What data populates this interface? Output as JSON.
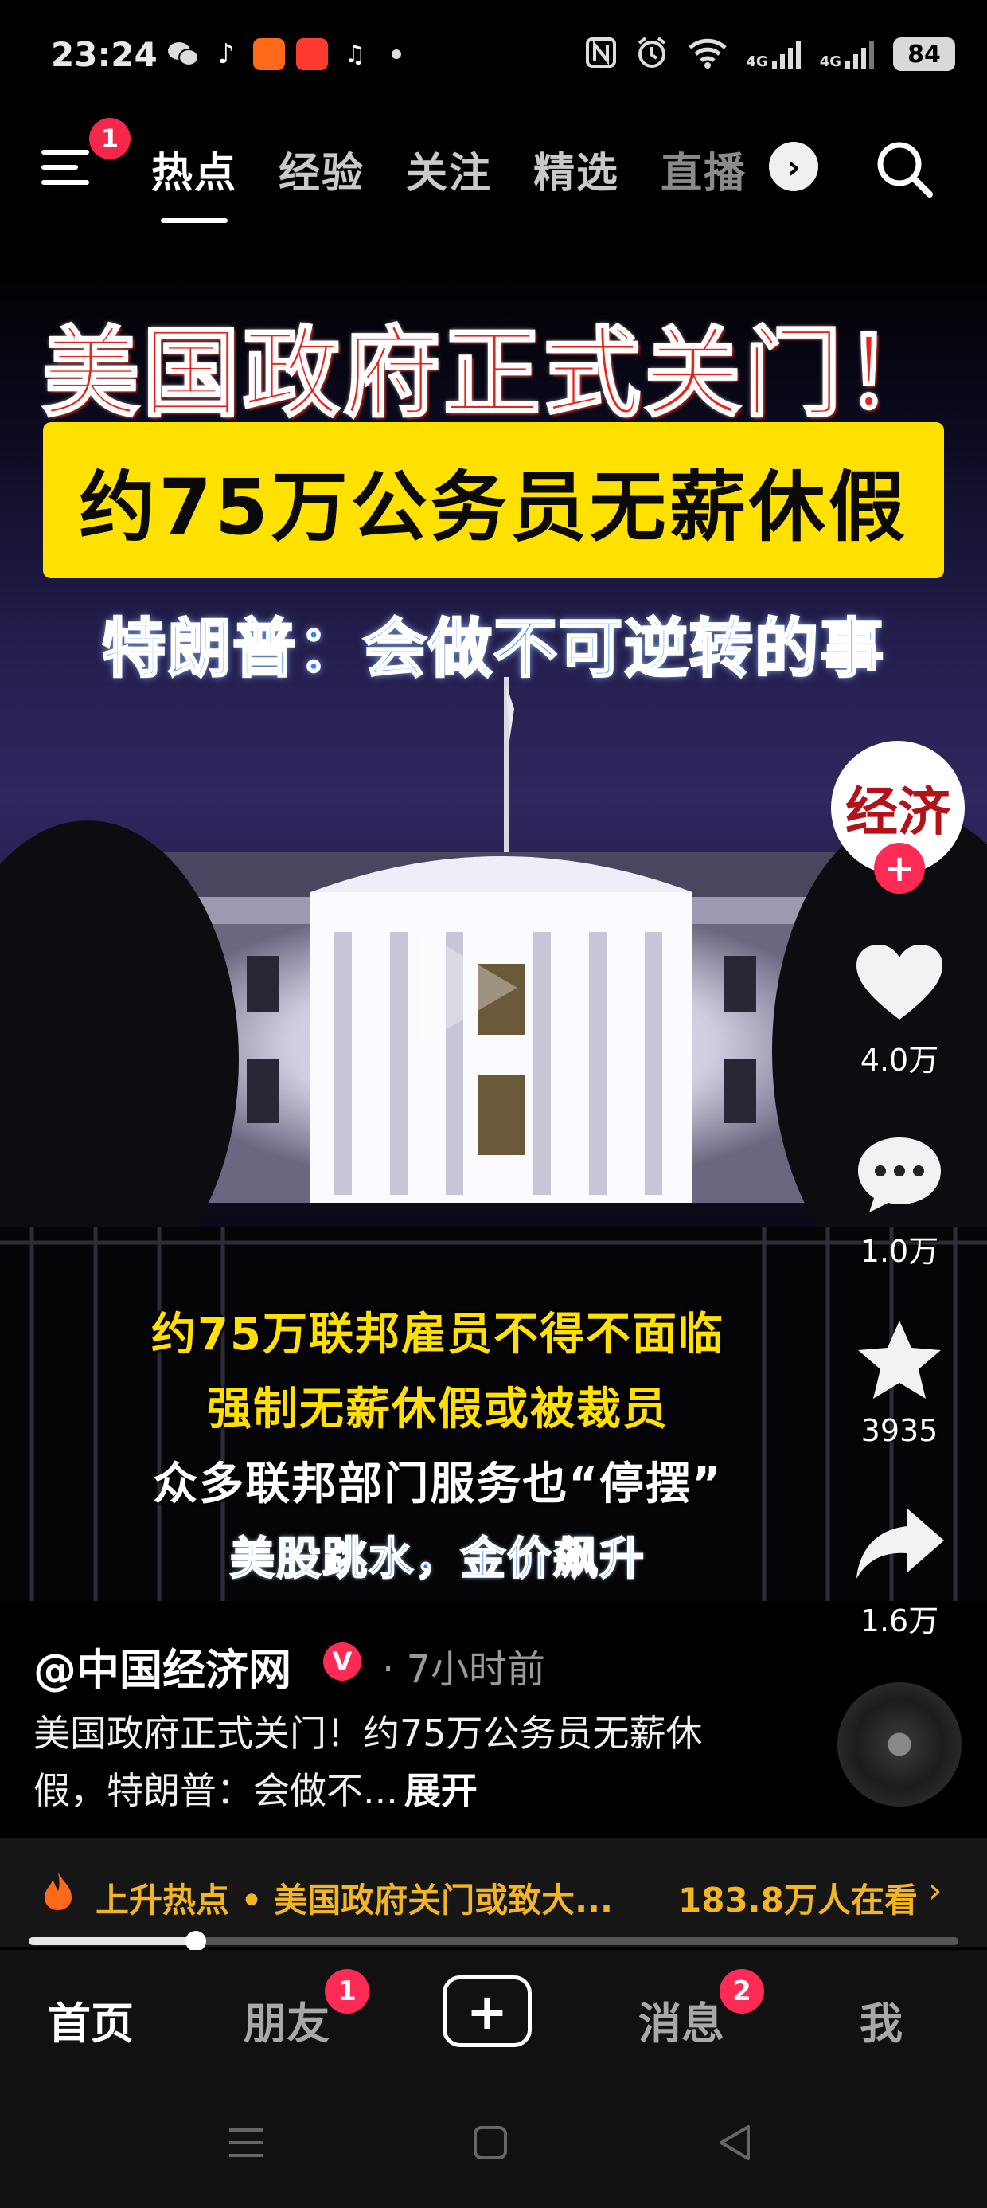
{
  "status_bar": {
    "time": "23:24",
    "network_label_1": "4G",
    "network_label_2": "4G",
    "battery": "84"
  },
  "top_nav": {
    "menu_badge": "1",
    "tabs": [
      {
        "label": "热点",
        "active": true
      },
      {
        "label": "经验",
        "active": false
      },
      {
        "label": "关注",
        "active": false
      },
      {
        "label": "精选",
        "active": false
      },
      {
        "label": "直播",
        "active": false
      }
    ],
    "more_icon": "chevron-right-icon",
    "search_icon": "search-icon"
  },
  "video": {
    "headline": "美国政府正式关门！",
    "banner": "约75万公务员无薪休假",
    "quote": "特朗普：会做不可逆转的事",
    "subtitles": [
      {
        "text": "约75万联邦雇员不得不面临",
        "style": "yellow"
      },
      {
        "text": "强制无薪休假或被裁员",
        "style": "yellow"
      },
      {
        "text": "众多联邦部门服务也“停摆”",
        "style": "white"
      },
      {
        "text": "美股跳水，金价飙升",
        "style": "blue"
      }
    ]
  },
  "actions": {
    "avatar_logo": "经济",
    "likes": "4.0万",
    "comments": "1.0万",
    "favorites": "3935",
    "shares": "1.6万"
  },
  "post": {
    "author": "@中国经济网",
    "verified_mark": "V",
    "time": "· 7小时前",
    "caption": "美国政府正式关门！约75万公务员无薪休假，特朗普：会做不...",
    "expand": "展开"
  },
  "trending": {
    "text": "上升热点 • 美国政府关门或致大...",
    "viewers": "183.8万人在看",
    "arrow": "›"
  },
  "playback": {
    "progress": 0.18
  },
  "bottom_nav": {
    "home": "首页",
    "friends": "朋友",
    "friends_badge": "1",
    "create": "+",
    "messages": "消息",
    "messages_badge": "2",
    "me": "我"
  },
  "colors": {
    "accent_red": "#fe2c55",
    "trend_gold": "#f3b521",
    "banner_yellow": "#ffe100"
  }
}
